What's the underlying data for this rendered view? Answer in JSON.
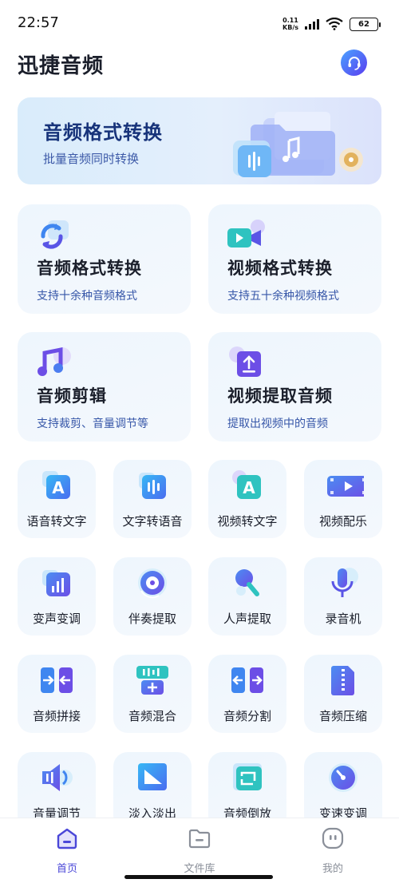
{
  "status": {
    "time": "22:57",
    "net_speed_value": "0.11",
    "net_speed_unit": "KB/s",
    "battery": "62"
  },
  "header": {
    "title": "迅捷音频"
  },
  "banner": {
    "title": "音频格式转换",
    "subtitle": "批量音频同时转换"
  },
  "big_cards": [
    {
      "title": "音频格式转换",
      "subtitle": "支持十余种音频格式",
      "icon": "refresh-convert-icon"
    },
    {
      "title": "视频格式转换",
      "subtitle": "支持五十余种视频格式",
      "icon": "video-camera-icon"
    },
    {
      "title": "音频剪辑",
      "subtitle": "支持裁剪、音量调节等",
      "icon": "music-note-icon"
    },
    {
      "title": "视频提取音频",
      "subtitle": "提取出视频中的音频",
      "icon": "upload-extract-icon"
    }
  ],
  "tools": [
    {
      "label": "语音转文字",
      "icon": "letter-a-icon"
    },
    {
      "label": "文字转语音",
      "icon": "waveform-icon"
    },
    {
      "label": "视频转文字",
      "icon": "letter-a-icon"
    },
    {
      "label": "视频配乐",
      "icon": "film-play-icon"
    },
    {
      "label": "变声变调",
      "icon": "bar-chart-icon"
    },
    {
      "label": "伴奏提取",
      "icon": "disc-icon"
    },
    {
      "label": "人声提取",
      "icon": "microphone-icon"
    },
    {
      "label": "录音机",
      "icon": "recorder-mic-icon"
    },
    {
      "label": "音频拼接",
      "icon": "merge-arrows-icon"
    },
    {
      "label": "音频混合",
      "icon": "mix-plus-icon"
    },
    {
      "label": "音频分割",
      "icon": "split-arrows-icon"
    },
    {
      "label": "音频压缩",
      "icon": "zip-file-icon"
    },
    {
      "label": "音量调节",
      "icon": "speaker-icon"
    },
    {
      "label": "淡入淡出",
      "icon": "fade-triangle-icon"
    },
    {
      "label": "音频倒放",
      "icon": "reverse-loop-icon"
    },
    {
      "label": "变速变调",
      "icon": "speed-gauge-icon"
    }
  ],
  "nav": [
    {
      "label": "首页",
      "icon": "home-icon",
      "active": true
    },
    {
      "label": "文件库",
      "icon": "folder-icon",
      "active": false
    },
    {
      "label": "我的",
      "icon": "profile-icon",
      "active": false
    }
  ],
  "colors": {
    "accent": "#4a47d8",
    "card_bg": "#eef6fd",
    "banner_title": "#17337a",
    "subtitle": "#3656a8"
  }
}
